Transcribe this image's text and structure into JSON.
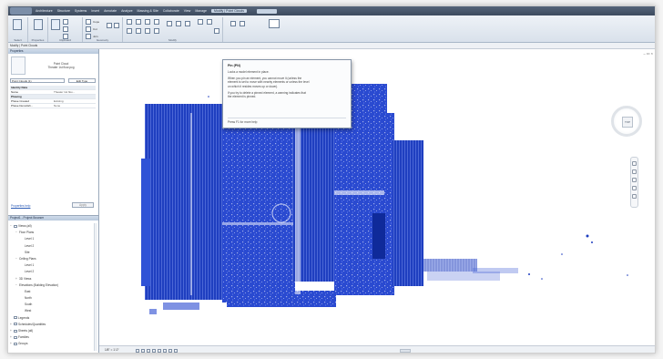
{
  "ribbon": {
    "tabs": [
      "Architecture",
      "Structure",
      "Systems",
      "Insert",
      "Annotate",
      "Analyze",
      "Massing & Site",
      "Collaborate",
      "View",
      "Manage",
      "Modify | Point Clouds"
    ],
    "active_tab": "Modify | Point Clouds",
    "groups": {
      "select": "Select",
      "properties": "Properties",
      "clipboard": "Clipboard",
      "geometry": "Geometry",
      "modify": "Modify"
    },
    "clipboard_items": [
      "Cope",
      "Cut",
      "Join"
    ]
  },
  "options_bar": {
    "label": "Modify | Point Clouds"
  },
  "properties": {
    "header": "Properties",
    "type_name_line1": "Point Cloud",
    "type_name_line2": "Theater 1st floor.pcg",
    "type_selector": "Point Clouds (1)",
    "edit_type": "Edit Type",
    "rows": [
      {
        "key": "Identity Data",
        "value": "",
        "section": true
      },
      {
        "key": "Name",
        "value": "Theater 1st floo...",
        "section": false
      },
      {
        "key": "Phasing",
        "value": "",
        "section": true
      },
      {
        "key": "Phase Created",
        "value": "Existing",
        "section": false
      },
      {
        "key": "Phase Demolish...",
        "value": "None",
        "section": false
      }
    ],
    "help_link": "Properties help",
    "apply": "Apply"
  },
  "project_browser": {
    "header": "Project1 - Project Browser",
    "items": [
      {
        "indent": 0,
        "toggle": "−",
        "label": "Views (all)",
        "icon": true
      },
      {
        "indent": 1,
        "toggle": "−",
        "label": "Floor Plans",
        "icon": false
      },
      {
        "indent": 2,
        "toggle": "",
        "label": "Level 1",
        "icon": false
      },
      {
        "indent": 2,
        "toggle": "",
        "label": "Level 2",
        "icon": false
      },
      {
        "indent": 2,
        "toggle": "",
        "label": "Site",
        "icon": false
      },
      {
        "indent": 1,
        "toggle": "−",
        "label": "Ceiling Plans",
        "icon": false
      },
      {
        "indent": 2,
        "toggle": "",
        "label": "Level 1",
        "icon": false
      },
      {
        "indent": 2,
        "toggle": "",
        "label": "Level 2",
        "icon": false
      },
      {
        "indent": 1,
        "toggle": "+",
        "label": "3D Views",
        "icon": false
      },
      {
        "indent": 1,
        "toggle": "−",
        "label": "Elevations (Building Elevation)",
        "icon": false
      },
      {
        "indent": 2,
        "toggle": "",
        "label": "East",
        "icon": false
      },
      {
        "indent": 2,
        "toggle": "",
        "label": "North",
        "icon": false
      },
      {
        "indent": 2,
        "toggle": "",
        "label": "South",
        "icon": false
      },
      {
        "indent": 2,
        "toggle": "",
        "label": "West",
        "icon": false
      },
      {
        "indent": 0,
        "toggle": "",
        "label": "Legends",
        "icon": true
      },
      {
        "indent": 0,
        "toggle": "+",
        "label": "Schedules/Quantities",
        "icon": true
      },
      {
        "indent": 0,
        "toggle": "+",
        "label": "Sheets (all)",
        "icon": true
      },
      {
        "indent": 0,
        "toggle": "+",
        "label": "Families",
        "icon": true
      },
      {
        "indent": 0,
        "toggle": "+",
        "label": "Groups",
        "icon": true
      }
    ]
  },
  "tooltip": {
    "title": "Pin (PN)",
    "lines1": [
      "Locks a model element in place."
    ],
    "lines2": [
      "When you pin an element, you cannot move it (unless the",
      "element is set to move with nearby elements or unless the level",
      "on which it resides moves up or down)."
    ],
    "lines3": [
      "If you try to delete a pinned element, a warning indicates that",
      "the element is pinned."
    ],
    "help": "Press F1 for more help"
  },
  "viewcube": {
    "face": "TOP"
  },
  "view_bar": {
    "scale": "1/8\" = 1'-0\""
  },
  "colors": {
    "point_cloud": "#1f3fc0",
    "ribbon_accent": "#3c4a5e"
  }
}
